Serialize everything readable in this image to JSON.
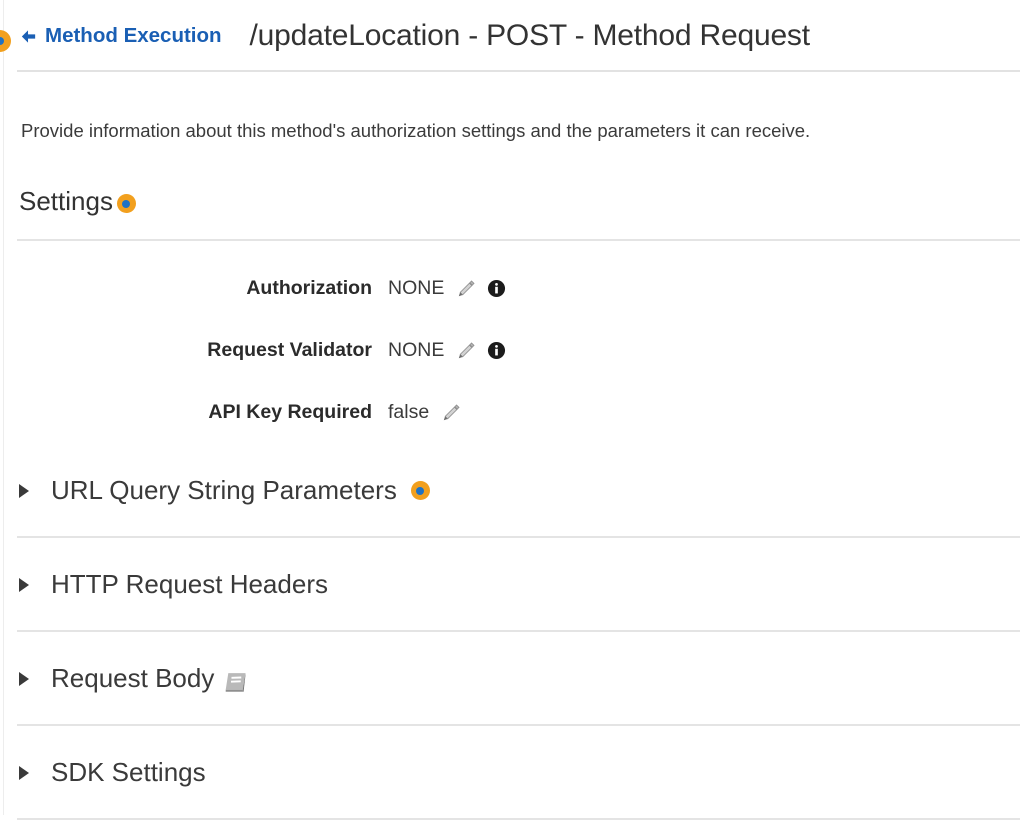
{
  "header": {
    "back_link_label": "Method Execution",
    "back_arrow_icon": "arrow-left-icon",
    "title": "/updateLocation - POST - Method Request",
    "link_color": "#1a5fb4",
    "edge_badge_icon": "help-badge-icon"
  },
  "description": "Provide information about this method's authorization settings and the parameters it can receive.",
  "settings": {
    "heading": "Settings",
    "heading_badge_icon": "help-badge-icon",
    "rows": [
      {
        "label": "Authorization",
        "value": "NONE",
        "edit_icon": "pencil-icon",
        "info_icon": "info-icon",
        "has_info": true
      },
      {
        "label": "Request Validator",
        "value": "NONE",
        "edit_icon": "pencil-icon",
        "info_icon": "info-icon",
        "has_info": true
      },
      {
        "label": "API Key Required",
        "value": "false",
        "edit_icon": "pencil-icon",
        "info_icon": "",
        "has_info": false
      }
    ]
  },
  "sections": [
    {
      "title": "URL Query String Parameters",
      "caret_icon": "caret-right-icon",
      "has_help_badge": true,
      "help_badge_icon": "help-badge-icon",
      "has_book_icon": false,
      "expanded": false
    },
    {
      "title": "HTTP Request Headers",
      "caret_icon": "caret-right-icon",
      "has_help_badge": false,
      "help_badge_icon": "",
      "has_book_icon": false,
      "expanded": false
    },
    {
      "title": "Request Body",
      "caret_icon": "caret-right-icon",
      "has_help_badge": false,
      "help_badge_icon": "",
      "has_book_icon": true,
      "book_icon": "book-icon",
      "expanded": false
    },
    {
      "title": "SDK Settings",
      "caret_icon": "caret-right-icon",
      "has_help_badge": false,
      "help_badge_icon": "",
      "has_book_icon": false,
      "expanded": false
    }
  ],
  "colors": {
    "badge_orange": "#f2a01e",
    "badge_center_blue": "#1f72c4",
    "link_blue": "#1a5fb4",
    "divider": "#e4e4e4",
    "text": "#333333",
    "icon_gray": "#9a9a9a"
  }
}
